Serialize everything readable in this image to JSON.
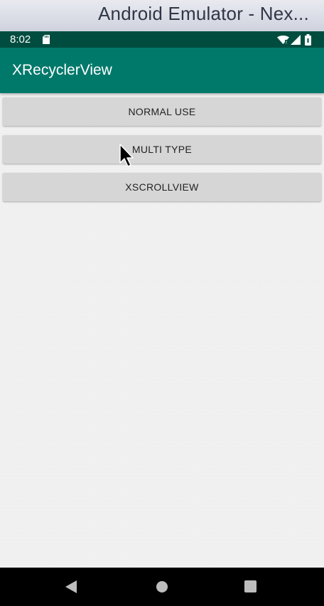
{
  "window": {
    "title": "Android Emulator - Nex..."
  },
  "status_bar": {
    "time": "8:02",
    "icons": [
      "sd-card-icon",
      "wifi-icon",
      "cell-signal-icon",
      "battery-icon"
    ],
    "background": "#004d40"
  },
  "app_bar": {
    "title": "XRecyclerView",
    "background": "#00796b"
  },
  "buttons": [
    {
      "label": "NORMAL USE"
    },
    {
      "label": "MULTI TYPE"
    },
    {
      "label": "XSCROLLVIEW"
    }
  ],
  "nav_bar": {
    "icons": [
      "back-icon",
      "home-icon",
      "recents-icon"
    ]
  },
  "colors": {
    "accent": "#00796b",
    "status_bar": "#004d40",
    "button_bg": "#d6d6d6",
    "content_bg": "#f1f1f1"
  }
}
